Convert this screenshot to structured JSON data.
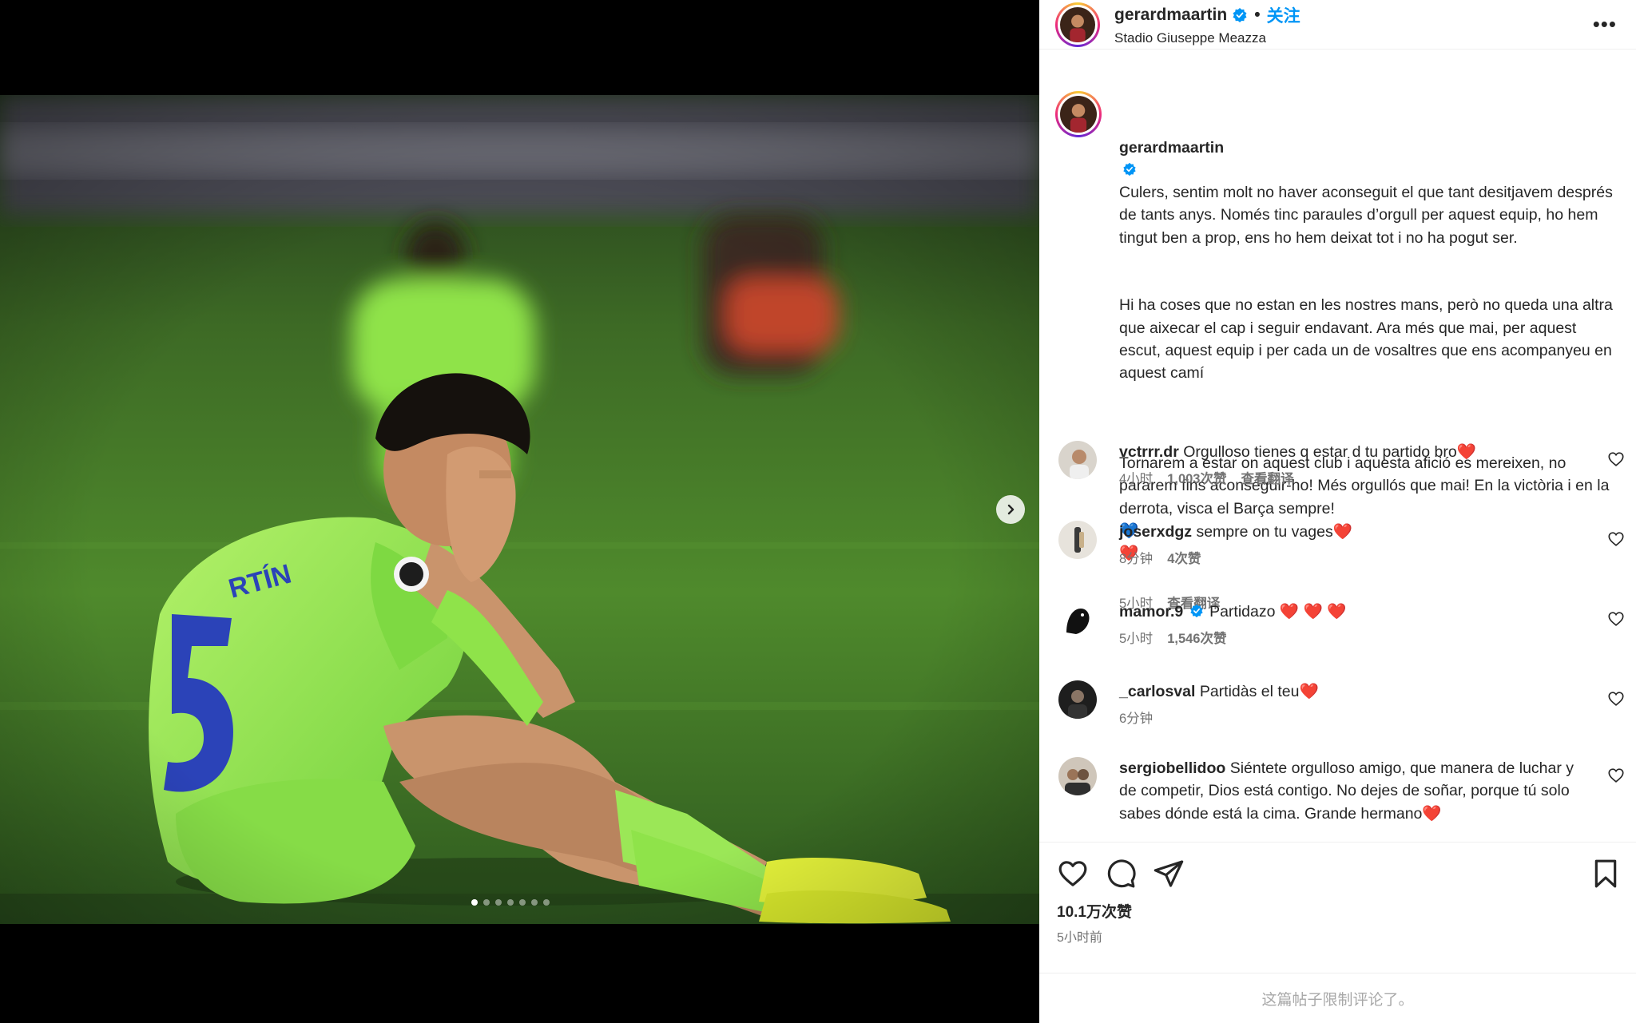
{
  "post": {
    "username": "gerardmaartin",
    "follow_label": "关注",
    "separator": "•",
    "location": "Stadio Giuseppe Meazza",
    "more_label": "•••",
    "caption_paragraphs": [
      "Culers, sentim molt no haver aconseguit el que tant desitjavem després de tants anys. Només tinc paraules d’orgull per aquest equip, ho hem tingut ben a prop, ens ho hem deixat tot i no ha pogut ser.",
      "Hi ha coses que no estan en les nostres mans, però no queda una altra que aixecar el cap i seguir endavant. Ara més que mai, per aquest escut, aquest equip i per cada un de vosaltres que ens acompanyeu en aquest camí",
      "Tornarem a estar on aquest club i aquesta afició es mereixen, no pararem fins aconseguir-ho! Més orgullós que mai! En la victòria i en la derrota, visca el Barça sempre!"
    ],
    "caption_emojis": [
      "💙",
      "❤️"
    ],
    "caption_time": "5小时",
    "see_translation": "查看翻译",
    "likes": "10.1万次赞",
    "posted_ago": "5小时前",
    "comments_limited": "这篇帖子限制评论了。"
  },
  "carousel": {
    "slide_count": 7,
    "active_index": 0,
    "next_icon": "chevron-right-icon"
  },
  "comments": [
    {
      "user": "vctrrr.dr",
      "verified": false,
      "text": "Orgulloso tienes q estar d tu partido bro",
      "emoji": "❤️",
      "time": "4小时",
      "likes": "1,003次赞",
      "translate": "查看翻译"
    },
    {
      "user": "joserxdgz",
      "verified": false,
      "text": "sempre on tu vages",
      "emoji": "❤️",
      "time": "8分钟",
      "likes": "4次赞",
      "translate": ""
    },
    {
      "user": "mamor.9",
      "verified": true,
      "text": "Partidazo",
      "emoji": "❤️ ❤️ ❤️",
      "time": "5小时",
      "likes": "1,546次赞",
      "translate": ""
    },
    {
      "user": "_carlosval",
      "verified": false,
      "text": "Partidàs el teu",
      "emoji": "❤️",
      "time": "6分钟",
      "likes": "",
      "translate": ""
    },
    {
      "user": "sergiobellidoo",
      "verified": false,
      "text": "Siéntete orgulloso amigo, que manera de luchar y de competir, Dios está contigo. No dejes de soñar, porque tú solo sabes dónde está la cima. Grande hermano",
      "emoji": "❤️",
      "time": "",
      "likes": "",
      "translate": ""
    }
  ],
  "icons": {
    "like": "heart-outline-icon",
    "comment": "speech-bubble-icon",
    "share": "paper-plane-icon",
    "save": "bookmark-icon",
    "verified": "verified-badge-icon"
  },
  "colors": {
    "accent_blue": "#0095f6",
    "heart_red": "#ed4956",
    "muted_text": "#737373",
    "jersey_green": "#8fe34a"
  }
}
